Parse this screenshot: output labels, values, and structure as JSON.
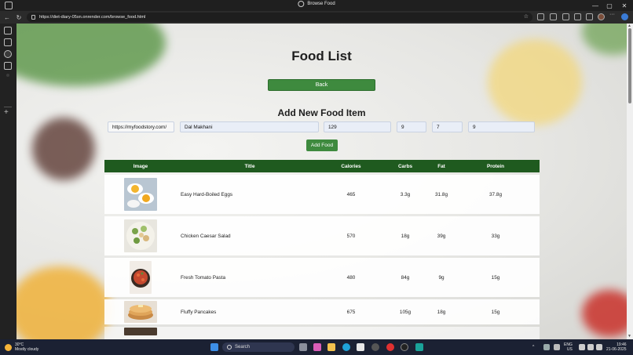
{
  "window": {
    "title": "Browse Food",
    "minimize": "—",
    "maximize": "▢",
    "close": "✕"
  },
  "browser": {
    "url": "https://diet-diary-05sn.onrender.com/browse_food.html",
    "back": "←",
    "reload": "↻",
    "favorite": "☆"
  },
  "page": {
    "title": "Food List",
    "back_label": "Back",
    "add_title": "Add New Food Item",
    "form": {
      "image_url": "https://myfoodstory.com/",
      "name": "Dal Makhani",
      "calories": "129",
      "carbs": "9",
      "fat": "7",
      "protein": "9"
    },
    "add_label": "Add Food",
    "table": {
      "headers": {
        "image": "Image",
        "title": "Title",
        "calories": "Calories",
        "carbs": "Carbs",
        "fat": "Fat",
        "protein": "Protein"
      },
      "rows": [
        {
          "title": "Easy Hard-Boiled Eggs",
          "calories": "465",
          "carbs": "3.3g",
          "fat": "31.8g",
          "protein": "37.8g"
        },
        {
          "title": "Chicken Caesar Salad",
          "calories": "570",
          "carbs": "18g",
          "fat": "39g",
          "protein": "33g"
        },
        {
          "title": "Fresh Tomato Pasta",
          "calories": "480",
          "carbs": "84g",
          "fat": "9g",
          "protein": "15g"
        },
        {
          "title": "Fluffy Pancakes",
          "calories": "675",
          "carbs": "105g",
          "fat": "18g",
          "protein": "15g"
        }
      ]
    }
  },
  "taskbar": {
    "weather_temp": "30°C",
    "weather_desc": "Mostly cloudy",
    "search_placeholder": "Search",
    "lang": "ENG",
    "region": "US",
    "time": "19:46",
    "date": "21-06-2025"
  },
  "colors": {
    "button_green": "#3e8a3e",
    "header_green": "#1f5a1f"
  }
}
